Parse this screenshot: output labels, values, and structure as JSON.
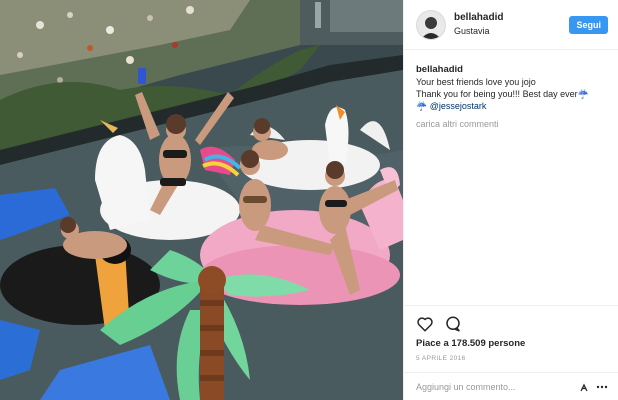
{
  "post": {
    "username": "bellahadid",
    "location": "Gustavia",
    "follow_label": "Segui",
    "caption_user": "bellahadid",
    "caption_lines": [
      "Your best friends love you jojo",
      "Thank you for being you!!! Best day ever",
      "@jessejostark"
    ],
    "caption_emoji": "☔",
    "load_more": "carica altri commenti",
    "likes_count": "Piace a 178.509 persone",
    "date": "5 APRILE 2016",
    "comment_placeholder": "Aggiungi un commento...",
    "icons": {
      "like": "heart-icon",
      "comment": "comment-bubble-icon",
      "save": "bookmark-icon",
      "more": "more-options-icon"
    }
  },
  "colors": {
    "follow_button": "#3897f0",
    "mention": "#003569",
    "muted": "#999999"
  }
}
